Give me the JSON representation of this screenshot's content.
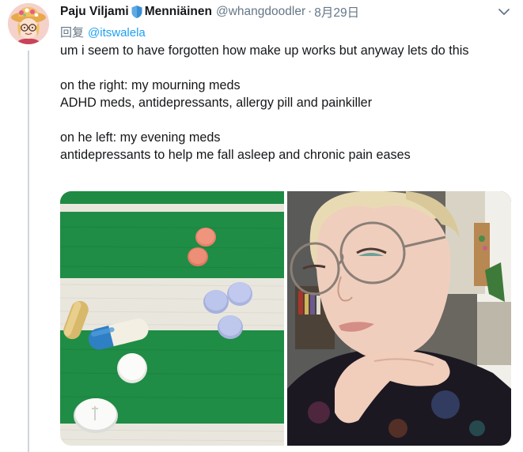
{
  "author": {
    "display_name_part1": "Paju Viljami",
    "display_name_part2": "Menniäinen",
    "handle": "@whangdoodler",
    "separator": "·",
    "date": "8月29日",
    "avatar_icon": "cartoon-avatar-with-flower-hat"
  },
  "reply": {
    "prefix": "回复",
    "mention": "@itswalela"
  },
  "tweet": {
    "lines": [
      "um i seem to have forgotten how make up works but anyway lets do this",
      "on the right: my mourning meds",
      "ADHD meds, antidepressants, allergy pill and painkiller",
      "on he left: my evening meds",
      "antidepressants to help me fall asleep and chronic pain eases"
    ]
  },
  "media": {
    "left_photo_icon": "pills-on-striped-cloth-photo",
    "right_photo_icon": "selfie-with-round-glasses-photo"
  },
  "colors": {
    "link": "#1da1f2",
    "secondary_text": "#657786",
    "thread_line": "#ccd6dd",
    "shield": "#3a8fd4"
  },
  "icons": {
    "shield": "shield-icon",
    "menu": "chevron-down-icon"
  }
}
